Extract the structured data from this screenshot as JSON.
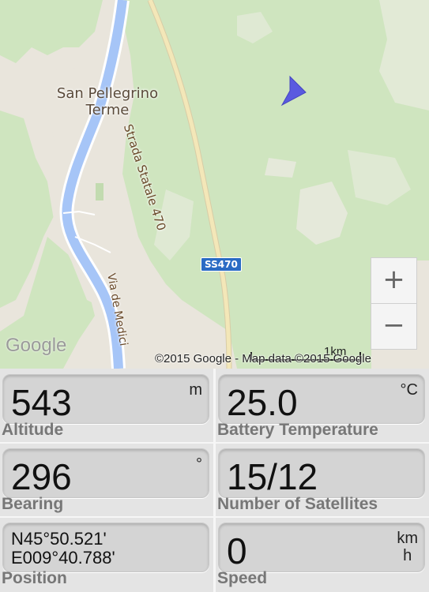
{
  "map": {
    "place_name": "San Pellegrino\nTerme",
    "road_label_1": "Strada Statale 470",
    "road_label_2": "Via de Medici",
    "road_shield": "SS470",
    "zoom_in": "+",
    "zoom_out": "−",
    "logo": "Google",
    "attribution": "©2015 Google - Map data ©2015 Google",
    "scale_label": "1km",
    "colors": {
      "forest": "#cfe5bf",
      "land": "#e9e5dc",
      "river": "#a6c5f7",
      "road": "#f3e7b8",
      "marker": "#5a5ae0"
    }
  },
  "stats": [
    {
      "label": "Altitude",
      "value": "543",
      "unit": "m"
    },
    {
      "label": "Battery Temperature",
      "value": "25.0",
      "unit": "°C"
    },
    {
      "label": "Bearing",
      "value": "296",
      "unit": "°"
    },
    {
      "label": "Number of Satellites",
      "value": "15/12",
      "unit": ""
    },
    {
      "label": "Position",
      "value": "N45°50.521'\nE009°40.788'",
      "unit": ""
    },
    {
      "label": "Speed",
      "value": "0",
      "unit": "km\nh"
    }
  ]
}
